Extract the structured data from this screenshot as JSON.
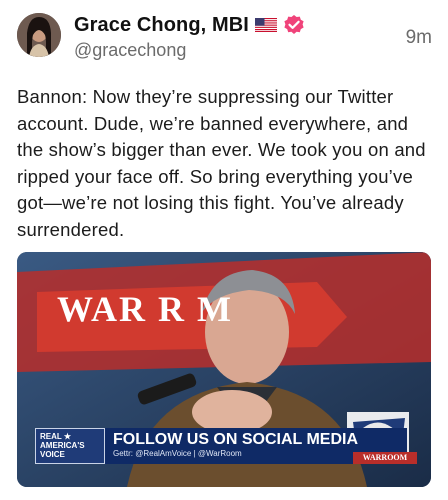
{
  "post": {
    "author_name": "Grace Chong, MBI",
    "author_handle": "@gracechong",
    "time": "9m",
    "text": "Bannon: Now they’re suppressing our Twitter account. Dude, we’re banned everywhere, and the show’s bigger than ever. We took you on and ripped your face off. So bring everything you’ve got—we’re not losing this fight. You’ve already surrendered."
  },
  "media": {
    "backdrop_text": "WAR R  M",
    "ticker_logo": "REAL ★ AMERICA'S VOICE",
    "ticker_title": "FOLLOW US ON SOCIAL MEDIA",
    "ticker_sub": "Gettr: @RealAmVoice | @WarRoom",
    "corner_logo_text": "WARROOM"
  },
  "colors": {
    "verified": "#f0437a",
    "text_primary": "#1c1c1c",
    "text_secondary": "#6b6b6b",
    "media_bg": "#243c5a",
    "banner_bg": "#0f2a66",
    "backdrop_red": "#c0312b"
  },
  "icons": [
    "us-flag-icon",
    "verified-badge-icon"
  ]
}
